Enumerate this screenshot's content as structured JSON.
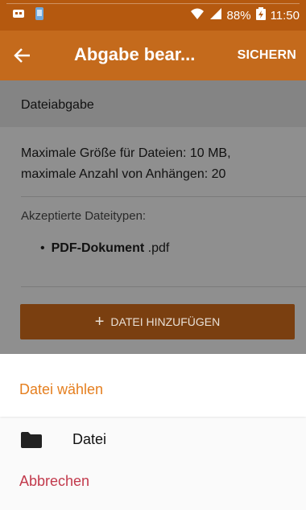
{
  "status_bar": {
    "battery": "88%",
    "time": "11:50"
  },
  "app_bar": {
    "title": "Abgabe bear...",
    "save_label": "SICHERN"
  },
  "content": {
    "section_header": "Dateiabgabe",
    "limits_line1": "Maximale Größe für Dateien: 10 MB,",
    "limits_line2": "maximale Anzahl von Anhängen: 20",
    "accepted_label": "Akzeptierte Dateitypen:",
    "filetypes": [
      {
        "name": "PDF-Dokument",
        "extension": ".pdf"
      }
    ],
    "add_button_label": "DATEI HINZUFÜGEN"
  },
  "sheet": {
    "title": "Datei wählen",
    "items": [
      {
        "icon": "folder-icon",
        "label": "Datei"
      }
    ],
    "cancel_label": "Abbrechen"
  },
  "colors": {
    "accent": "#e57f1f",
    "app_bar": "#c46a1c",
    "cancel": "#c23a4c"
  }
}
